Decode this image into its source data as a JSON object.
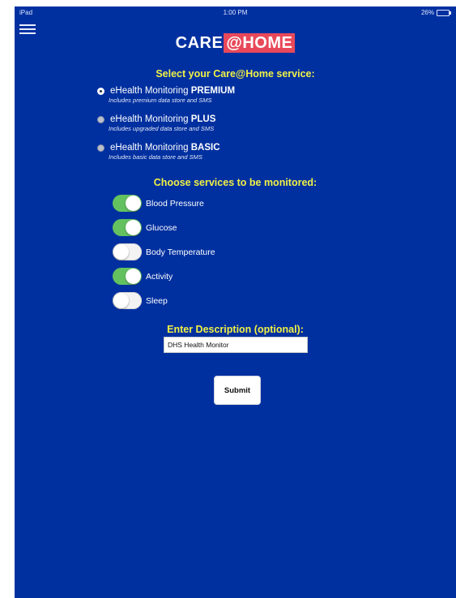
{
  "status_bar": {
    "device": "iPad",
    "time": "1:00 PM",
    "battery_text": "26%",
    "battery_level": 0.26
  },
  "logo": {
    "part1": "CARE",
    "part2": "@HOME",
    "highlight_color": "#e8495a"
  },
  "service_section": {
    "title": "Select your Care@Home service:",
    "options": [
      {
        "prefix": "eHealth Monitoring",
        "tier": "PREMIUM",
        "subtitle": "Includes premium data store and SMS",
        "selected": true
      },
      {
        "prefix": "eHealth Monitoring",
        "tier": "PLUS",
        "subtitle": "Includes upgraded data store and SMS",
        "selected": false
      },
      {
        "prefix": "eHealth Monitoring",
        "tier": "BASIC",
        "subtitle": "Includes basic data store and SMS",
        "selected": false
      }
    ]
  },
  "monitor_section": {
    "title": "Choose services to be monitored:",
    "toggles": [
      {
        "label": "Blood Pressure",
        "on": true
      },
      {
        "label": "Glucose",
        "on": true
      },
      {
        "label": "Body Temperature",
        "on": false
      },
      {
        "label": "Activity",
        "on": true
      },
      {
        "label": "Sleep",
        "on": false
      }
    ]
  },
  "description": {
    "title": "Enter Description (optional):",
    "value": "DHS Health Monitor"
  },
  "submit": {
    "label": "Submit"
  },
  "colors": {
    "background": "#0030a0",
    "heading": "#f2f046",
    "toggle_on": "#63c160",
    "arrow": "#6dbb2a"
  }
}
